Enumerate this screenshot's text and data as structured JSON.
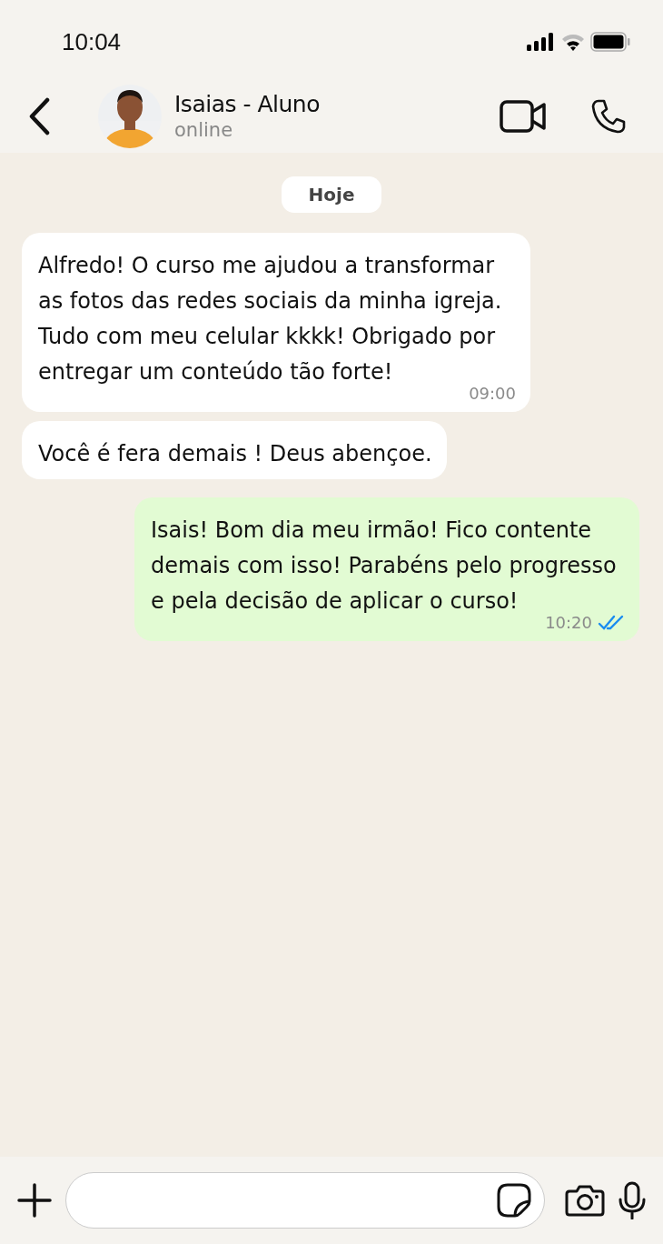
{
  "status_bar": {
    "time": "10:04"
  },
  "header": {
    "contact_name": "Isaias - Aluno",
    "presence": "online"
  },
  "chat": {
    "date_chip": "Hoje",
    "messages": [
      {
        "kind": "incoming",
        "text": "Alfredo! O curso me ajudou a transformar as fotos das redes sociais da minha igreja. Tudo com meu celular kkkk! Obrigado por entregar um conteúdo tão forte!",
        "time": "09:00"
      },
      {
        "kind": "incoming",
        "text": "Você é fera demais ! Deus abençoe."
      },
      {
        "kind": "outgoing",
        "text": "Isais! Bom dia meu irmão! Fico contente demais com isso! Parabéns pelo progresso e pela decisão de aplicar o curso!",
        "time": "10:20",
        "read": true
      }
    ]
  }
}
